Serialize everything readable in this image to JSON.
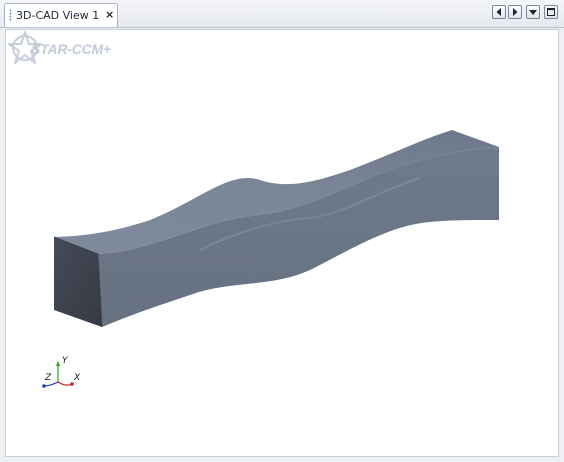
{
  "tab": {
    "title": "3D-CAD View 1",
    "close_glyph": "×"
  },
  "nav": {
    "prev_icon": "arrow-left-icon",
    "next_icon": "arrow-right-icon",
    "menu_icon": "dropdown-menu-icon",
    "maximize_icon": "maximize-icon"
  },
  "viewport": {
    "logo_text": "STAR-CCM+",
    "axes": {
      "y": "Y",
      "z": "Z",
      "x": "X"
    }
  },
  "colors": {
    "model_top": "#7a8799",
    "model_side": "#6a7586",
    "model_end": "#3c414c",
    "axis_x": "#cc2222",
    "axis_y": "#22aa22",
    "axis_z": "#2233cc"
  }
}
